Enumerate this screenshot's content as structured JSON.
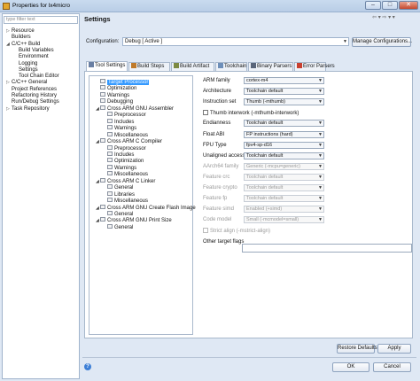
{
  "window": {
    "title": "Properties for lx4micro"
  },
  "sidebar": {
    "filter_placeholder": "type filter text",
    "items": [
      {
        "label": "Resource",
        "level": 0,
        "twisty": "closed"
      },
      {
        "label": "Builders",
        "level": 0,
        "twisty": "none"
      },
      {
        "label": "C/C++ Build",
        "level": 0,
        "twisty": "open"
      },
      {
        "label": "Build Variables",
        "level": 1,
        "twisty": "none"
      },
      {
        "label": "Environment",
        "level": 1,
        "twisty": "none"
      },
      {
        "label": "Logging",
        "level": 1,
        "twisty": "none"
      },
      {
        "label": "Settings",
        "level": 1,
        "twisty": "none"
      },
      {
        "label": "Tool Chain Editor",
        "level": 1,
        "twisty": "none"
      },
      {
        "label": "C/C++ General",
        "level": 0,
        "twisty": "closed"
      },
      {
        "label": "Project References",
        "level": 0,
        "twisty": "none"
      },
      {
        "label": "Refactoring History",
        "level": 0,
        "twisty": "none"
      },
      {
        "label": "Run/Debug Settings",
        "level": 0,
        "twisty": "none"
      },
      {
        "label": "Task Repository",
        "level": 0,
        "twisty": "closed"
      }
    ]
  },
  "main": {
    "heading": "Settings",
    "configuration_label": "Configuration:",
    "configuration_value": "Debug  [ Active ]",
    "manage_label": "Manage Configurations...",
    "tabs": [
      {
        "label": "Tool Settings",
        "active": true,
        "icon": "tools-icon"
      },
      {
        "label": "Build Steps",
        "active": false,
        "icon": "steps-icon"
      },
      {
        "label": "Build Artifact",
        "active": false,
        "icon": "artifact-icon"
      },
      {
        "label": "Toolchain",
        "active": false,
        "icon": "toolchain-icon"
      },
      {
        "label": "Binary Parsers",
        "active": false,
        "icon": "binary-icon"
      },
      {
        "label": "Error Parsers",
        "active": false,
        "icon": "error-icon"
      }
    ]
  },
  "tool_tree": [
    {
      "label": "Target Processor",
      "level": 0,
      "twisty": "none",
      "selected": true
    },
    {
      "label": "Optimization",
      "level": 0,
      "twisty": "none"
    },
    {
      "label": "Warnings",
      "level": 0,
      "twisty": "none"
    },
    {
      "label": "Debugging",
      "level": 0,
      "twisty": "none"
    },
    {
      "label": "Cross ARM GNU Assembler",
      "level": 0,
      "twisty": "open"
    },
    {
      "label": "Preprocessor",
      "level": 1,
      "twisty": "none"
    },
    {
      "label": "Includes",
      "level": 1,
      "twisty": "none"
    },
    {
      "label": "Warnings",
      "level": 1,
      "twisty": "none"
    },
    {
      "label": "Miscellaneous",
      "level": 1,
      "twisty": "none"
    },
    {
      "label": "Cross ARM C Compiler",
      "level": 0,
      "twisty": "open"
    },
    {
      "label": "Preprocessor",
      "level": 1,
      "twisty": "none"
    },
    {
      "label": "Includes",
      "level": 1,
      "twisty": "none"
    },
    {
      "label": "Optimization",
      "level": 1,
      "twisty": "none"
    },
    {
      "label": "Warnings",
      "level": 1,
      "twisty": "none"
    },
    {
      "label": "Miscellaneous",
      "level": 1,
      "twisty": "none"
    },
    {
      "label": "Cross ARM C Linker",
      "level": 0,
      "twisty": "open"
    },
    {
      "label": "General",
      "level": 1,
      "twisty": "none"
    },
    {
      "label": "Libraries",
      "level": 1,
      "twisty": "none"
    },
    {
      "label": "Miscellaneous",
      "level": 1,
      "twisty": "none"
    },
    {
      "label": "Cross ARM GNU Create Flash Image",
      "level": 0,
      "twisty": "open"
    },
    {
      "label": "General",
      "level": 1,
      "twisty": "none"
    },
    {
      "label": "Cross ARM GNU Print Size",
      "level": 0,
      "twisty": "open"
    },
    {
      "label": "General",
      "level": 1,
      "twisty": "none"
    }
  ],
  "properties": [
    {
      "kind": "select",
      "label": "ARM family",
      "value": "cortex-m4",
      "disabled": false
    },
    {
      "kind": "select",
      "label": "Architecture",
      "value": "Toolchain default",
      "disabled": false
    },
    {
      "kind": "select",
      "label": "Instruction set",
      "value": "Thumb (-mthumb)",
      "disabled": false
    },
    {
      "kind": "check",
      "label": "Thumb interwork (-mthumb-interwork)",
      "checked": false,
      "disabled": false
    },
    {
      "kind": "select",
      "label": "Endianness",
      "value": "Toolchain default",
      "disabled": false
    },
    {
      "kind": "select",
      "label": "Float ABI",
      "value": "FP instructions (hard)",
      "disabled": false
    },
    {
      "kind": "select",
      "label": "FPU Type",
      "value": "fpv4-sp-d16",
      "disabled": false
    },
    {
      "kind": "select",
      "label": "Unaligned access",
      "value": "Toolchain default",
      "disabled": false
    },
    {
      "kind": "select",
      "label": "AArch64 family",
      "value": "Generic (-mcpu=generic)",
      "disabled": true
    },
    {
      "kind": "select",
      "label": "Feature crc",
      "value": "Toolchain default",
      "disabled": true
    },
    {
      "kind": "select",
      "label": "Feature crypto",
      "value": "Toolchain default",
      "disabled": true
    },
    {
      "kind": "select",
      "label": "Feature fp",
      "value": "Toolchain default",
      "disabled": true
    },
    {
      "kind": "select",
      "label": "Feature simd",
      "value": "Enabled (+simd)",
      "disabled": true
    },
    {
      "kind": "select",
      "label": "Code model",
      "value": "Small (-mcmodel=small)",
      "disabled": true
    },
    {
      "kind": "check",
      "label": "Strict align (-mstrict-align)",
      "checked": false,
      "disabled": true
    },
    {
      "kind": "text",
      "label": "Other target flags",
      "value": ""
    }
  ],
  "buttons": {
    "restore_defaults": "Restore Defaults",
    "apply": "Apply",
    "ok": "OK",
    "cancel": "Cancel",
    "help": "?"
  },
  "window_buttons": {
    "minimize": "–",
    "maximize": "□",
    "close": "✕"
  }
}
